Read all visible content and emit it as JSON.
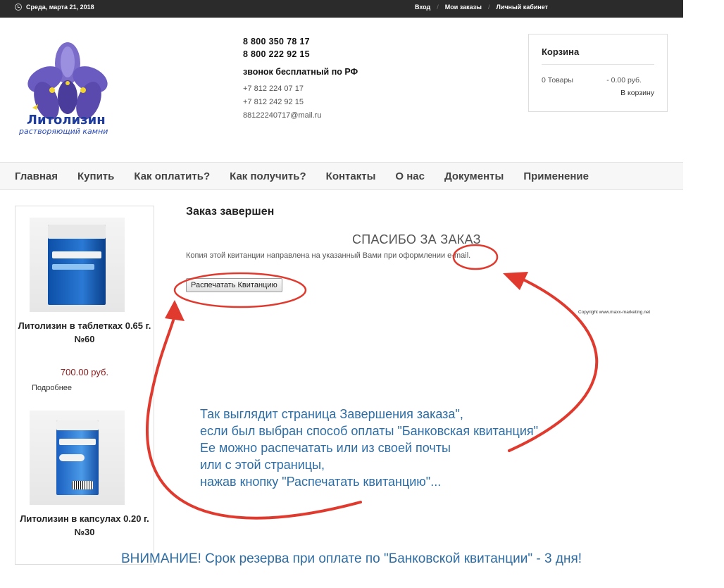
{
  "topbar": {
    "date": "Среда, марта 21, 2018",
    "links": [
      "Вход",
      "Мои заказы",
      "Личный кабинет"
    ]
  },
  "logo": {
    "name": "Литолизин",
    "tagline": "растворяющий камни"
  },
  "contacts": {
    "phone1": "8 800 350 78 17",
    "phone2": "8 800 222 92 15",
    "free_call": "звонок бесплатный по РФ",
    "phone3": "+7 812 224 07 17",
    "phone4": "+7 812 242 92 15",
    "email": "88122240717@mail.ru"
  },
  "cart": {
    "title": "Корзина",
    "items": "0 Товары",
    "total": "- 0.00 руб.",
    "link": "В корзину"
  },
  "nav": [
    "Главная",
    "Купить",
    "Как оплатить?",
    "Как получить?",
    "Контакты",
    "О нас",
    "Документы",
    "Применение"
  ],
  "sidebar": {
    "products": [
      {
        "name": "Литолизин в таблетках 0.65 г. №60",
        "price": "700.00 руб.",
        "more": "Подробнее"
      },
      {
        "name": "Литолизин в капсулах 0.20 г. №30"
      }
    ]
  },
  "main": {
    "title": "Заказ завершен",
    "thanks": "СПАСИБО ЗА ЗАКАЗ",
    "copy_note": "Копия этой квитанции направлена на указанный Вами при оформлении e-mail.",
    "print_button": "Распечатать Квитанцию",
    "copyright": "Copyright www.maxx-marketing.net"
  },
  "annotation": {
    "text": "Так выглядит страница Завершения заказа\",\nесли был выбран способ оплаты \"Банковская квитанция\".\nЕе можно распечатать или из своей почты\nили с этой страницы,\nнажав кнопку \"Распечатать квитанцию\"...",
    "warning": "ВНИМАНИЕ! Срок резерва при оплате по \"Банковской квитанции\" - 3 дня!",
    "color": "#2e6da4",
    "arrow_color": "#e03a2f"
  },
  "colors": {
    "topbar": "#2b2b2b",
    "price": "#8b1a1a",
    "logo_blue": "#1d3c9c"
  }
}
